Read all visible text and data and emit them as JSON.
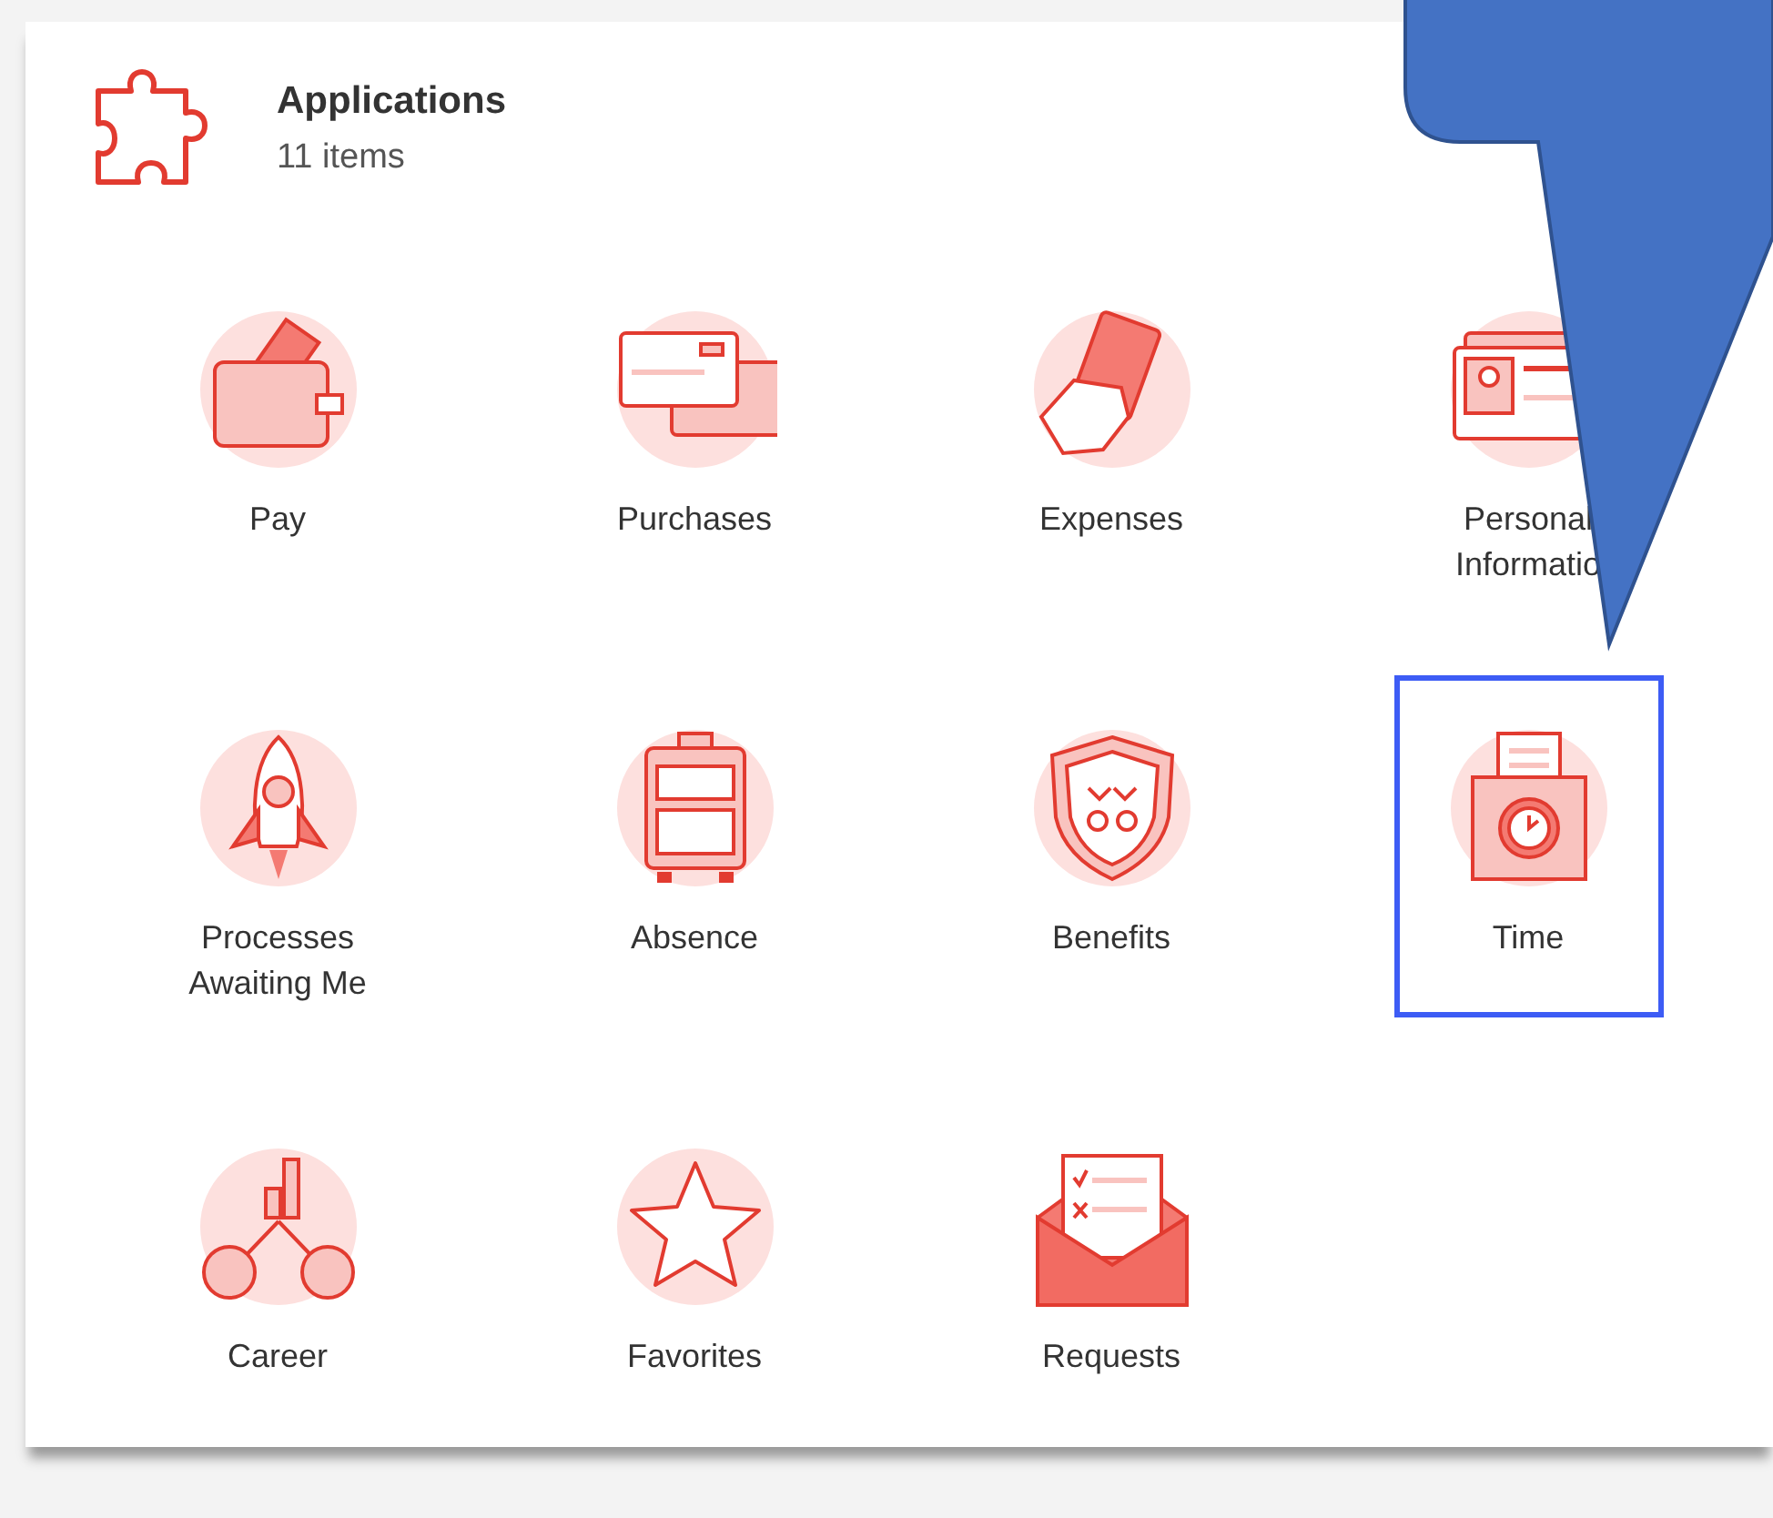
{
  "header": {
    "title": "Applications",
    "count": "11 items"
  },
  "apps": [
    {
      "label": "Pay",
      "selected": false
    },
    {
      "label": "Purchases",
      "selected": false
    },
    {
      "label": "Expenses",
      "selected": false
    },
    {
      "label": "Personal Informatio",
      "selected": false
    },
    {
      "label": "Processes Awaiting Me",
      "selected": false
    },
    {
      "label": "Absence",
      "selected": false
    },
    {
      "label": "Benefits",
      "selected": false
    },
    {
      "label": "Time",
      "selected": true
    },
    {
      "label": "Career",
      "selected": false
    },
    {
      "label": "Favorites",
      "selected": false
    },
    {
      "label": "Requests",
      "selected": false
    }
  ]
}
